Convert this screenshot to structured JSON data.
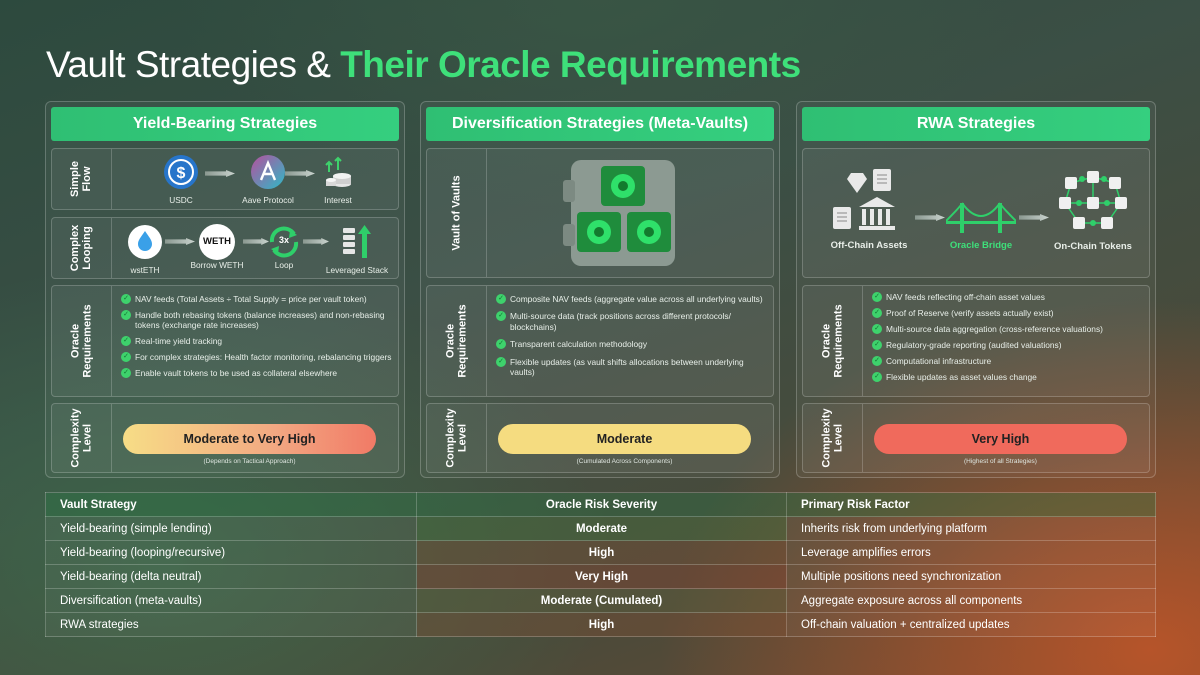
{
  "title": {
    "part1": "Vault Strategies & ",
    "part2": "Their Oracle Requirements"
  },
  "panels": {
    "yield": {
      "heading": "Yield-Bearing Strategies",
      "simple": {
        "label": "Simple\nFlow",
        "items": [
          "USDC",
          "Aave Protocol",
          "Interest"
        ]
      },
      "looping": {
        "label": "Complex\nLooping",
        "items": [
          "wstETH",
          "Borrow WETH",
          "Loop",
          "Leveraged Stack"
        ],
        "weth_text": "WETH",
        "loop_text": "3x"
      },
      "oracle": {
        "label": "Oracle\nRequirements",
        "bullets": [
          "NAV feeds (Total Assets ÷ Total Supply = price per vault token)",
          "Handle both rebasing tokens (balance increases) and non-rebasing tokens (exchange rate increases)",
          "Real-time yield tracking",
          "For complex strategies: Health factor monitoring, rebalancing triggers",
          "Enable vault tokens to be used as collateral elsewhere"
        ]
      },
      "complexity": {
        "label": "Complexity\nLevel",
        "value": "Moderate to Very High",
        "note": "(Depends on Tactical Approach)"
      }
    },
    "divers": {
      "heading": "Diversification Strategies (Meta-Vaults)",
      "vault": {
        "label": "Vault of Vaults"
      },
      "oracle": {
        "label": "Oracle\nRequirements",
        "bullets": [
          "Composite NAV feeds (aggregate value across all underlying vaults)",
          "Multi-source data (track positions across different protocols/ blockchains)",
          "Transparent calculation methodology",
          "Flexible updates (as vault shifts allocations between underlying vaults)"
        ]
      },
      "complexity": {
        "label": "Complexity\nLevel",
        "value": "Moderate",
        "note": "(Cumulated Across Components)"
      }
    },
    "rwa": {
      "heading": "RWA Strategies",
      "flow": {
        "items": [
          "Off-Chain Assets",
          "Oracle Bridge",
          "On-Chain Tokens"
        ]
      },
      "oracle": {
        "label": "Oracle\nRequirements",
        "bullets": [
          "NAV feeds reflecting off-chain asset values",
          "Proof of Reserve (verify assets actually exist)",
          "Multi-source data aggregation (cross-reference valuations)",
          "Regulatory-grade reporting (audited valuations)",
          "Computational infrastructure",
          "Flexible updates as asset values change"
        ]
      },
      "complexity": {
        "label": "Complexity\nLevel",
        "value": "Very High",
        "note": "(Highest of all Strategies)"
      }
    }
  },
  "table": {
    "headers": [
      "Vault Strategy",
      "Oracle Risk Severity",
      "Primary Risk Factor"
    ],
    "rows": [
      [
        "Yield-bearing (simple lending)",
        "Moderate",
        "Inherits risk from underlying platform"
      ],
      [
        "Yield-bearing (looping/recursive)",
        "High",
        "Leverage amplifies errors"
      ],
      [
        "Yield-bearing (delta neutral)",
        "Very High",
        "Multiple positions need synchronization"
      ],
      [
        "Diversification (meta-vaults)",
        "Moderate (Cumulated)",
        "Aggregate exposure across all components"
      ],
      [
        "RWA strategies",
        "High",
        "Off-chain valuation + centralized updates"
      ]
    ]
  },
  "colors": {
    "accent": "#3ee07a",
    "header_green": "#2fbf73",
    "moderate_pill": "#f5dc80",
    "high_pill": "#f06a5c"
  }
}
